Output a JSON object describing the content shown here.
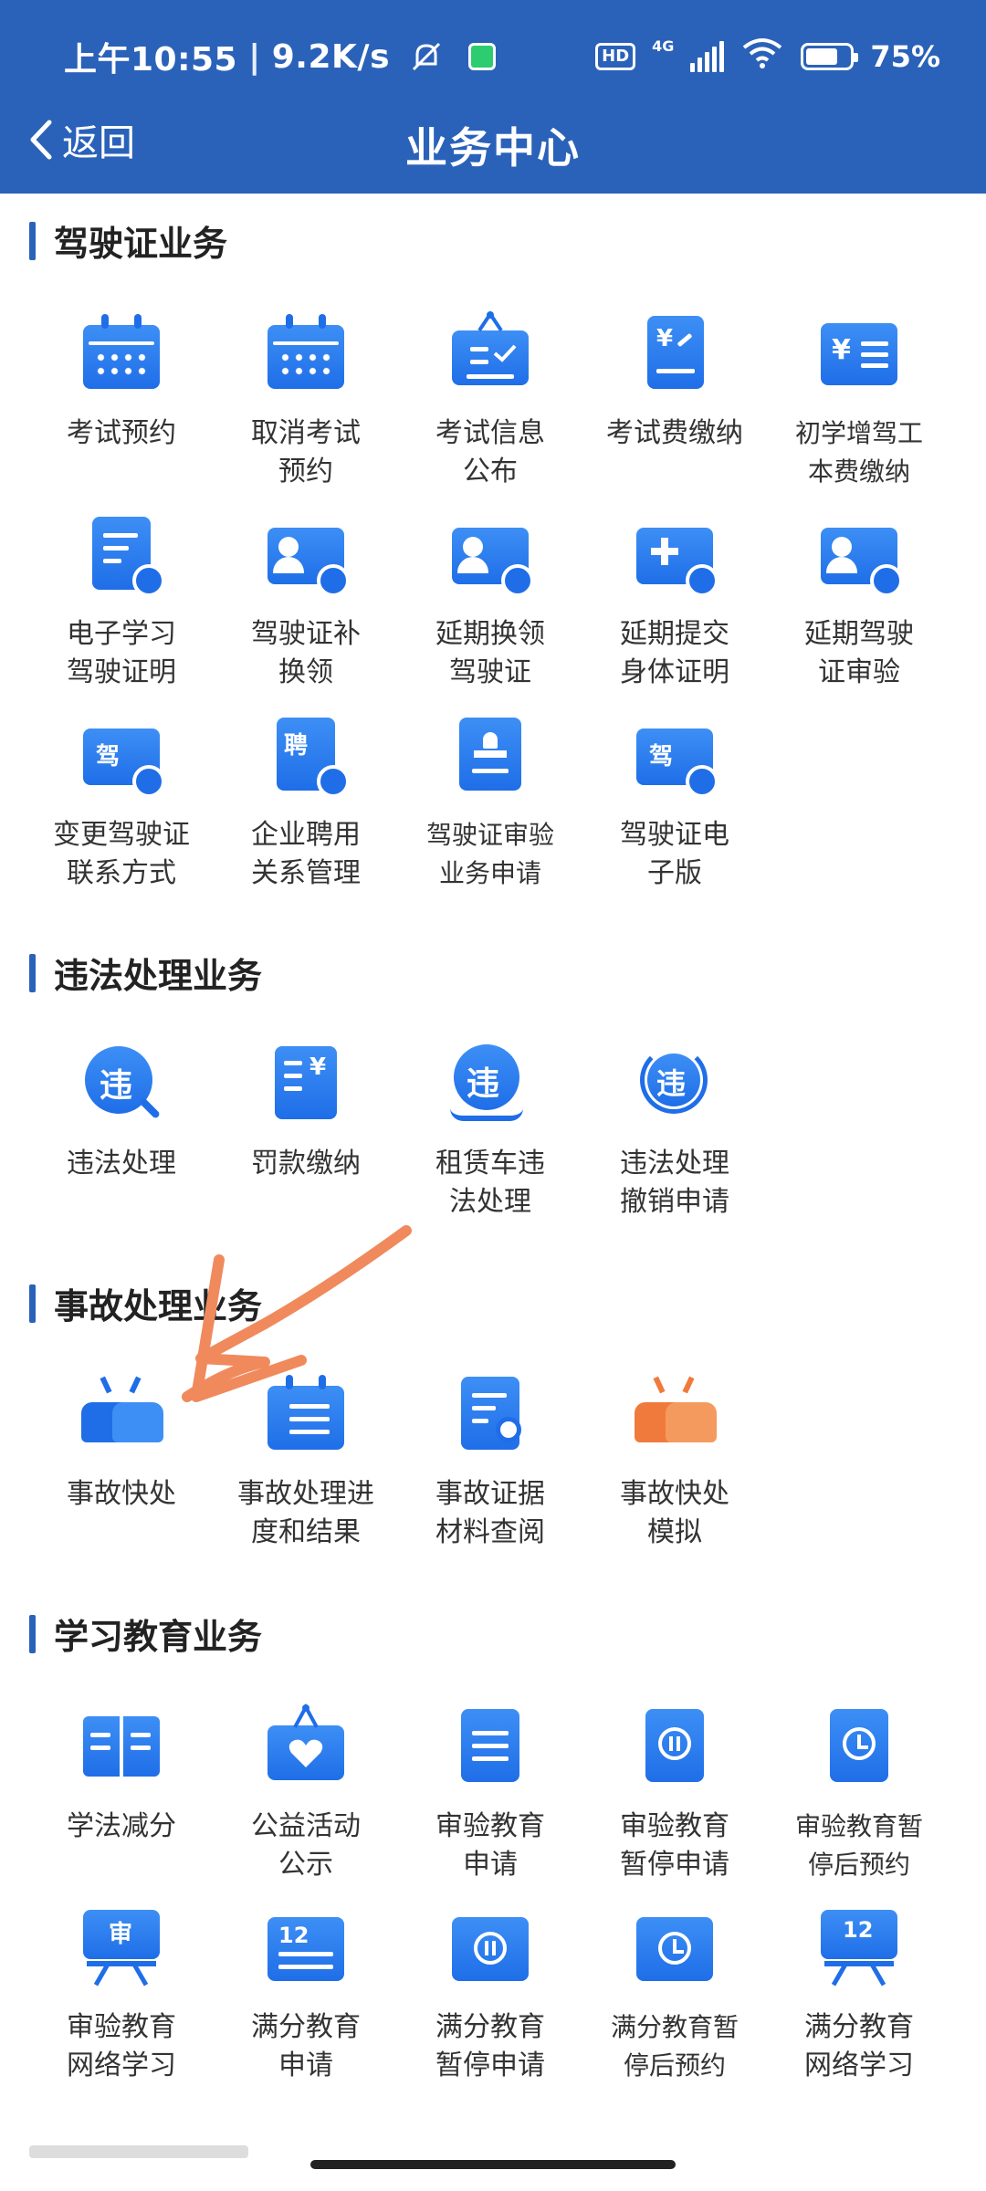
{
  "status": {
    "time": "上午10:55",
    "speed": "9.2K/s",
    "network": "4G",
    "hd": "HD",
    "battery": "75%"
  },
  "nav": {
    "back_label": "返回",
    "title": "业务中心"
  },
  "sections": {
    "license": {
      "title": "驾驶证业务",
      "items": [
        "考试预约",
        "取消考试\n预约",
        "考试信息\n公布",
        "考试费缴纳",
        "初学增驾工\n本费缴纳",
        "电子学习\n驾驶证明",
        "驾驶证补\n换领",
        "延期换领\n驾驶证",
        "延期提交\n身体证明",
        "延期驾驶\n证审验",
        "变更驾驶证\n联系方式",
        "企业聘用\n关系管理",
        "驾驶证审验\n业务申请",
        "驾驶证电\n子版"
      ]
    },
    "violation": {
      "title": "违法处理业务",
      "items": [
        "违法处理",
        "罚款缴纳",
        "租赁车违\n法处理",
        "违法处理\n撤销申请"
      ]
    },
    "accident": {
      "title": "事故处理业务",
      "items": [
        "事故快处",
        "事故处理进\n度和结果",
        "事故证据\n材料查阅",
        "事故快处\n模拟"
      ]
    },
    "education": {
      "title": "学习教育业务",
      "items": [
        "学法减分",
        "公益活动\n公示",
        "审验教育\n申请",
        "审验教育\n暂停申请",
        "审验教育暂\n停后预约",
        "审验教育\n网络学习",
        "满分教育\n申请",
        "满分教育\n暂停申请",
        "满分教育暂\n停后预约",
        "满分教育\n网络学习"
      ]
    }
  },
  "icon_glyphs": {
    "yen": "¥",
    "jia": "驾",
    "pin": "聘",
    "wei": "违",
    "shen": "审",
    "twelve": "12"
  },
  "colors": {
    "header": "#2a62b9",
    "icon_blue": "#1f6ee8",
    "accent_orange": "#f07a3c",
    "annotation_arrow": "#f08a5d"
  }
}
